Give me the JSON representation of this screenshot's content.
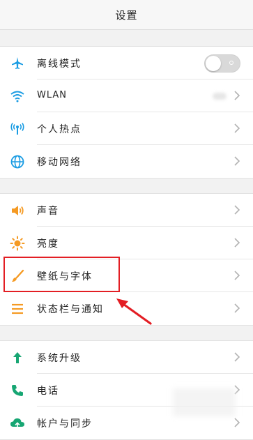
{
  "header": {
    "title": "设置"
  },
  "groups": [
    {
      "items": [
        {
          "label": "离线模式",
          "icon": "airplane-icon",
          "control": "toggle",
          "toggle_on": false
        },
        {
          "label": "WLAN",
          "icon": "wifi-icon",
          "control": "chevron"
        },
        {
          "label": "个人热点",
          "icon": "hotspot-icon",
          "control": "chevron"
        },
        {
          "label": "移动网络",
          "icon": "globe-icon",
          "control": "chevron"
        }
      ]
    },
    {
      "items": [
        {
          "label": "声音",
          "icon": "speaker-icon",
          "control": "chevron"
        },
        {
          "label": "亮度",
          "icon": "sun-icon",
          "control": "chevron"
        },
        {
          "label": "壁纸与字体",
          "icon": "brush-icon",
          "control": "chevron"
        },
        {
          "label": "状态栏与通知",
          "icon": "menu-lines-icon",
          "control": "chevron"
        }
      ]
    },
    {
      "items": [
        {
          "label": "系统升级",
          "icon": "up-arrow-icon",
          "control": "chevron"
        },
        {
          "label": "电话",
          "icon": "phone-icon",
          "control": "chevron"
        },
        {
          "label": "帐户与同步",
          "icon": "cloud-sync-icon",
          "control": "chevron"
        }
      ]
    }
  ],
  "colors": {
    "icon_blue": "#1a9ce3",
    "icon_orange": "#f59a23",
    "icon_green": "#17a673",
    "annotation_red": "#e31e24"
  }
}
